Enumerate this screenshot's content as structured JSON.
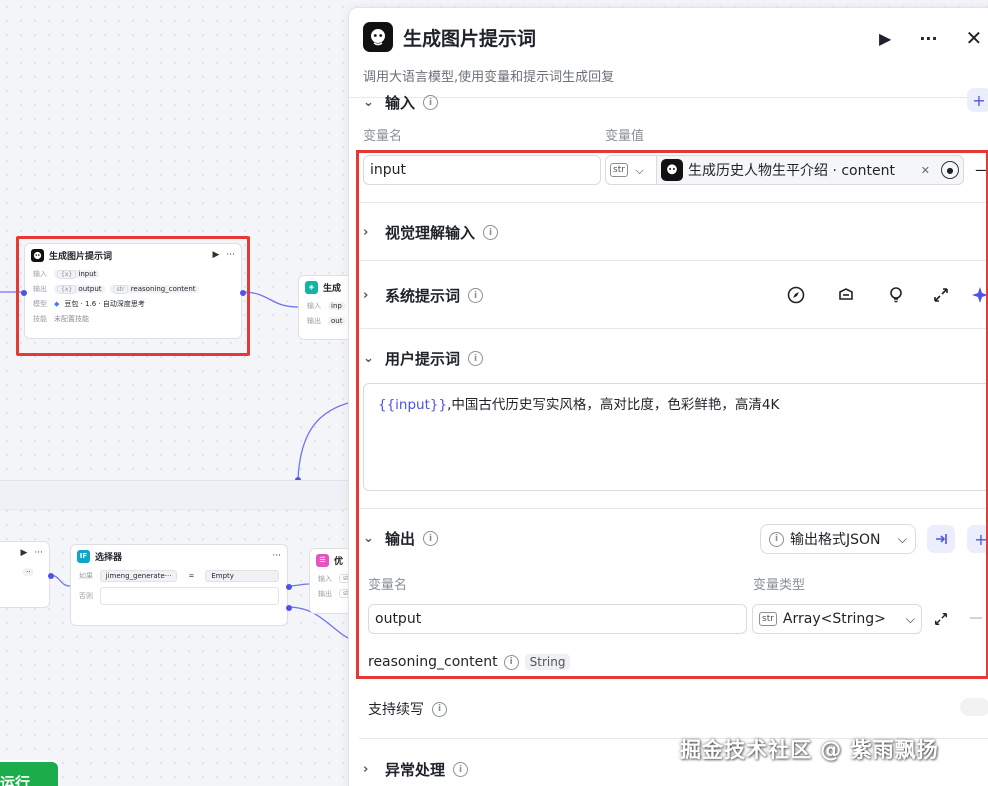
{
  "canvas": {
    "main_node": {
      "title": "生成图片提示词",
      "rows": [
        {
          "key": "输入",
          "type": "{x}",
          "value": "input"
        },
        {
          "key": "输出",
          "type": "{x}",
          "value": "output",
          "type2": "str",
          "value2": "reasoning_content"
        },
        {
          "key": "模型",
          "value": "豆包 · 1.6 · 自动深度思考"
        },
        {
          "key": "技能",
          "value": "未配置技能"
        }
      ]
    },
    "gen_node": {
      "title": "生成",
      "rows": [
        {
          "key": "输入",
          "value": "inp"
        },
        {
          "key": "输出",
          "value": "out"
        }
      ]
    },
    "selector_node": {
      "title": "选择器",
      "if_label": "如果",
      "condition_left": "jimeng_generate···",
      "operator": "=",
      "condition_right": "Empty",
      "else_label": "否则"
    },
    "opt_node": {
      "title": "优",
      "rows": [
        {
          "key": "输入",
          "value": "str"
        },
        {
          "key": "输出",
          "value": "str"
        }
      ]
    },
    "run_label": "运行"
  },
  "panel": {
    "title": "生成图片提示词",
    "description": "调用大语言模型,使用变量和提示词生成回复",
    "input_section": {
      "label": "输入",
      "col_name": "变量名",
      "col_value": "变量值",
      "var_name": "input",
      "type_tag": "str",
      "ref_text": "生成历史人物生平介绍 · content"
    },
    "vision_section": {
      "label": "视觉理解输入"
    },
    "system_section": {
      "label": "系统提示词"
    },
    "user_section": {
      "label": "用户提示词",
      "prompt_var": "{{input}}",
      "prompt_text": ",中国古代历史写实风格，高对比度，色彩鲜艳，高清4K"
    },
    "output_section": {
      "label": "输出",
      "format_button": "输出格式JSON",
      "col_name": "变量名",
      "col_type": "变量类型",
      "var_name": "output",
      "type_tag": "str",
      "type_value": "Array<String>",
      "extra_name": "reasoning_content",
      "extra_type": "String"
    },
    "continue_label": "支持续写",
    "exception_label": "异常处理"
  },
  "watermark": "掘金技术社区 @ 紫雨飘扬",
  "colors": {
    "accent": "#4d53e8",
    "highlight": "#e53935",
    "run": "#1aad49"
  }
}
